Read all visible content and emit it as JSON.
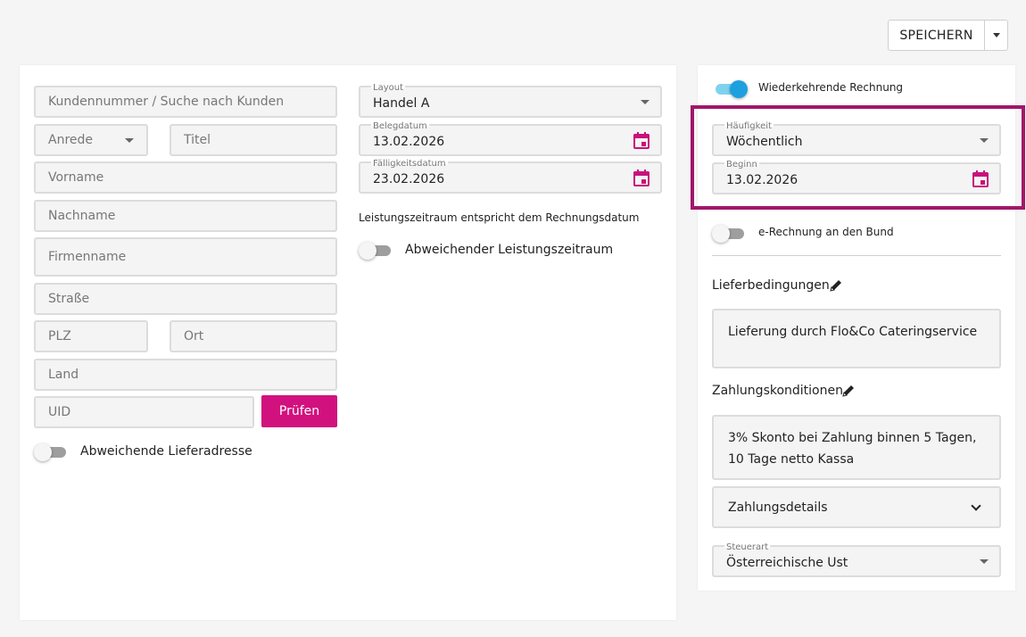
{
  "toolbar": {
    "save_label": "SPEICHERN"
  },
  "customer": {
    "search_placeholder": "Kundennummer / Suche nach Kunden",
    "salutation_placeholder": "Anrede",
    "title_placeholder": "Titel",
    "firstname_placeholder": "Vorname",
    "lastname_placeholder": "Nachname",
    "company_placeholder": "Firmenname",
    "street_placeholder": "Straße",
    "zip_placeholder": "PLZ",
    "city_placeholder": "Ort",
    "country_placeholder": "Land",
    "uid_placeholder": "UID",
    "check_button": "Prüfen",
    "alt_delivery_label": "Abweichende Lieferadresse"
  },
  "document": {
    "layout_label": "Layout",
    "layout_value": "Handel A",
    "date_label": "Belegdatum",
    "date_value": "13.02.2026",
    "due_label": "Fälligkeitsdatum",
    "due_value": "23.02.2026",
    "service_period_note": "Leistungszeitraum entspricht dem Rechnungsdatum",
    "alt_service_period_label": "Abweichender Leistungszeitraum"
  },
  "recurring": {
    "toggle_label": "Wiederkehrende Rechnung",
    "toggle_on": true,
    "frequency_label": "Häufigkeit",
    "frequency_value": "Wöchentlich",
    "start_label": "Beginn",
    "start_value": "13.02.2026",
    "erechnung_label": "e-Rechnung an den Bund",
    "erechnung_on": false
  },
  "terms": {
    "delivery_title": "Lieferbedingungen",
    "delivery_text": "Lieferung durch Flo&Co Cateringservice",
    "payment_title": "Zahlungskonditionen",
    "payment_text": "3% Skonto bei Zahlung binnen 5 Tagen, 10 Tage netto Kassa",
    "payment_details_label": "Zahlungsdetails",
    "tax_label": "Steuerart",
    "tax_value": "Österreichische Ust"
  },
  "colors": {
    "accent": "#d1127e",
    "toggle_on": "#1ea0de",
    "highlight": "#a1176a"
  },
  "icons": {
    "calendar": "calendar-icon",
    "dropdown": "caret-down-icon",
    "pencil": "pencil-icon",
    "chevron": "chevron-down-icon"
  }
}
